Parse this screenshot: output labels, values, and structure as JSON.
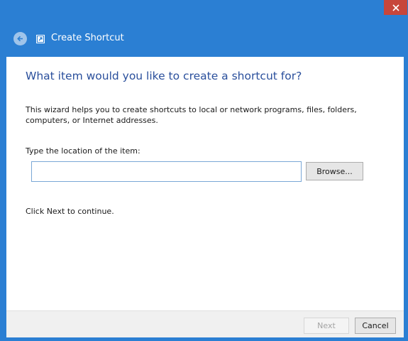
{
  "window": {
    "title": "Create Shortcut",
    "close_icon": "close-icon",
    "back_icon": "back-arrow-icon",
    "app_icon": "shortcut-icon",
    "colors": {
      "titlebar": "#2b7fd3",
      "close": "#c7463b",
      "heading": "#2a4f9c"
    }
  },
  "wizard": {
    "heading": "What item would you like to create a shortcut for?",
    "description": "This wizard helps you to create shortcuts to local or network programs, files, folders, computers, or Internet addresses.",
    "location_label": "Type the location of the item:",
    "location_value": "",
    "location_placeholder": "",
    "browse_label": "Browse...",
    "continue_text": "Click Next to continue."
  },
  "footer": {
    "next_label": "Next",
    "next_enabled": false,
    "cancel_label": "Cancel"
  }
}
